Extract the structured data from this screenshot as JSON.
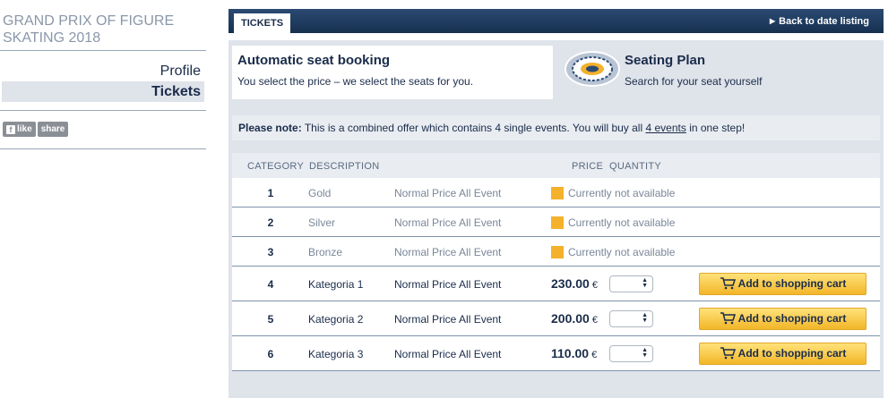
{
  "sidebar": {
    "event_title": "GRAND PRIX OF FIGURE SKATING 2018",
    "nav": [
      {
        "label": "Profile",
        "active": false
      },
      {
        "label": "Tickets",
        "active": true
      }
    ],
    "social": {
      "like_label": "like",
      "share_label": "share"
    }
  },
  "topbar": {
    "tab_label": "TICKETS",
    "back_label": "Back to date listing"
  },
  "booking": {
    "auto": {
      "title": "Automatic seat booking",
      "subtitle": "You select the price – we select the seats for you."
    },
    "seating": {
      "title": "Seating Plan",
      "subtitle": "Search for your seat yourself"
    }
  },
  "note": {
    "lead": "Please note:",
    "text_before": " This is a combined offer which contains 4 single events. You will buy all ",
    "link": "4 events",
    "text_after": " in one step!"
  },
  "table": {
    "headers": {
      "category": "CATEGORY",
      "description": "DESCRIPTION",
      "price": "PRICE",
      "quantity": "QUANTITY"
    },
    "rows": [
      {
        "category": "1",
        "description": "Gold",
        "type": "Normal Price All Event",
        "status": "Currently not available"
      },
      {
        "category": "2",
        "description": "Silver",
        "type": "Normal Price All Event",
        "status": "Currently not available"
      },
      {
        "category": "3",
        "description": "Bronze",
        "type": "Normal Price All Event",
        "status": "Currently not available"
      },
      {
        "category": "4",
        "description": "Kategoria 1",
        "type": "Normal Price All Event",
        "price": "230.00",
        "currency": "€",
        "cart_label": "Add to shopping cart"
      },
      {
        "category": "5",
        "description": "Kategoria 2",
        "type": "Normal Price All Event",
        "price": "200.00",
        "currency": "€",
        "cart_label": "Add to shopping cart"
      },
      {
        "category": "6",
        "description": "Kategoria 3",
        "type": "Normal Price All Event",
        "price": "110.00",
        "currency": "€",
        "cart_label": "Add to shopping cart"
      }
    ]
  },
  "colors": {
    "navy": "#1a2c4a",
    "topbar": "#1d3a5f",
    "panel": "#dfe3ea",
    "unavailable": "#f4b12c",
    "cart_button": "#f7cc4a"
  },
  "icons": {
    "like": "facebook-icon",
    "back": "arrow-right-icon",
    "seating": "stadium-icon",
    "unavailable": "unavailable-square-icon",
    "cart": "shopping-cart-icon",
    "stepper": "stepper-arrows-icon"
  }
}
